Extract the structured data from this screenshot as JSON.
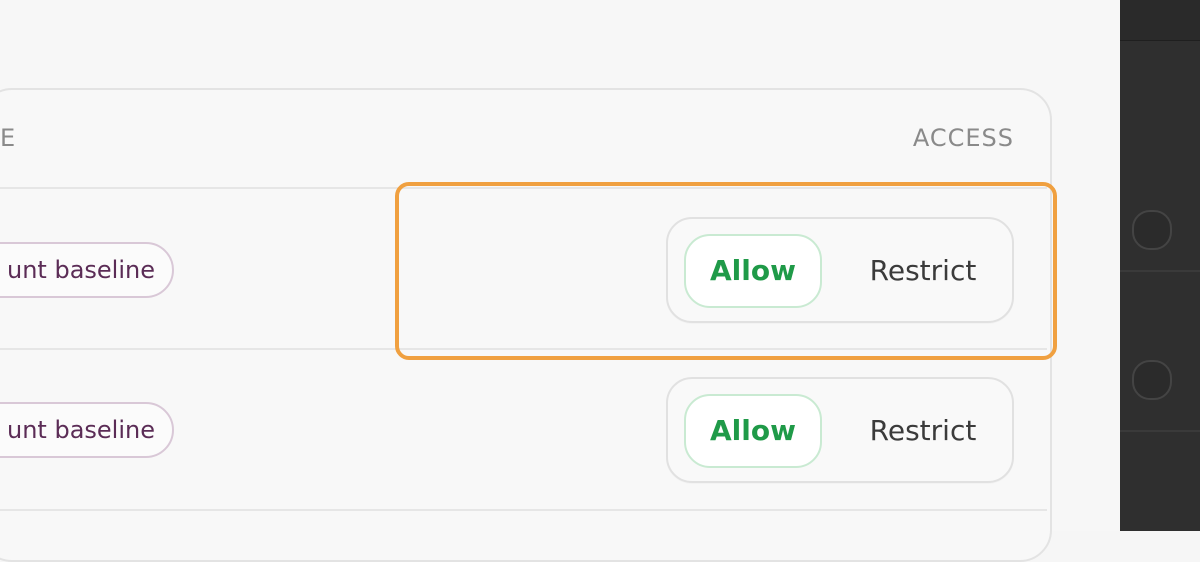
{
  "table": {
    "headers": {
      "left_partial": "E",
      "access": "ACCESS"
    },
    "rows": [
      {
        "tag": "unt baseline",
        "allow": "Allow",
        "restrict": "Restrict"
      },
      {
        "tag": "unt baseline",
        "allow": "Allow",
        "restrict": "Restrict"
      }
    ]
  },
  "colors": {
    "highlight": "#f0a040",
    "allow_text": "#1f9a48",
    "tag_text": "#5b2c56"
  }
}
